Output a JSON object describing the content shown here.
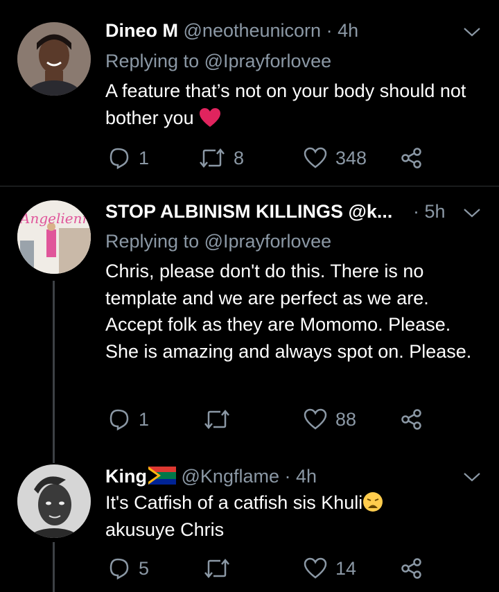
{
  "tweets": [
    {
      "name": "Dineo M",
      "handle": "@neotheunicorn",
      "sep": "·",
      "time": "4h",
      "replying_label": "Replying to",
      "replying_to": "@Iprayforlovee",
      "text": "A feature that’s not on your body should not bother you",
      "emoji": "heart",
      "replies": "1",
      "retweets": "8",
      "likes": "348"
    },
    {
      "name": "STOP ALBINISM KILLINGS",
      "handle": "@k...",
      "sep": "·",
      "time": "5h",
      "replying_label": "Replying to",
      "replying_to": "@Iprayforlovee",
      "text": "Chris, please don't do this. There is no template and we are perfect as we are. Accept folk as they are Momomo. Please. She is amazing and always spot on. Please.",
      "avatar_text": "Angelienn",
      "replies": "1",
      "retweets": "",
      "likes": "88"
    },
    {
      "name": "King",
      "handle": "@Kngflame",
      "sep": "·",
      "time": "4h",
      "text": "It's Catfish of a catfish sis Khuli",
      "text2": "akusuye Chris",
      "emoji": "weary-face",
      "replies": "5",
      "retweets": "",
      "likes": "14"
    }
  ],
  "colors": {
    "background": "#000000",
    "muted": "#8b98a5",
    "divider": "#2f3336",
    "heart": "#e0245e"
  }
}
